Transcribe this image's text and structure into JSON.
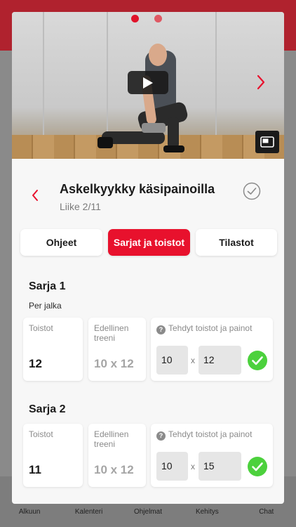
{
  "background_tabs": [
    "Alkuun",
    "Kalenteri",
    "Ohjelmat",
    "Kehitys",
    "Chat"
  ],
  "video": {
    "slide_count": 2,
    "active_slide": 1
  },
  "exercise": {
    "title": "Askelkyykky käsipainoilla",
    "subtitle": "Liike 2/11"
  },
  "tabs": [
    {
      "label": "Ohjeet",
      "active": false
    },
    {
      "label": "Sarjat ja toistot",
      "active": true
    },
    {
      "label": "Tilastot",
      "active": false
    }
  ],
  "sets": [
    {
      "title": "Sarja 1",
      "note": "Per jalka",
      "reps_label": "Toistot",
      "reps": "12",
      "previous_label": "Edellinen treeni",
      "previous": "10 x 12",
      "done_label": "Tehdyt toistot ja painot",
      "done_weight": "10",
      "times": "x",
      "done_reps": "12"
    },
    {
      "title": "Sarja 2",
      "reps_label": "Toistot",
      "reps": "11",
      "previous_label": "Edellinen treeni",
      "previous": "10 x 12",
      "done_label": "Tehdyt toistot ja painot",
      "done_weight": "10",
      "times": "x",
      "done_reps": "15"
    }
  ],
  "icons": {
    "help": "?"
  },
  "colors": {
    "accent": "#e8112d",
    "success": "#4cd13d"
  }
}
